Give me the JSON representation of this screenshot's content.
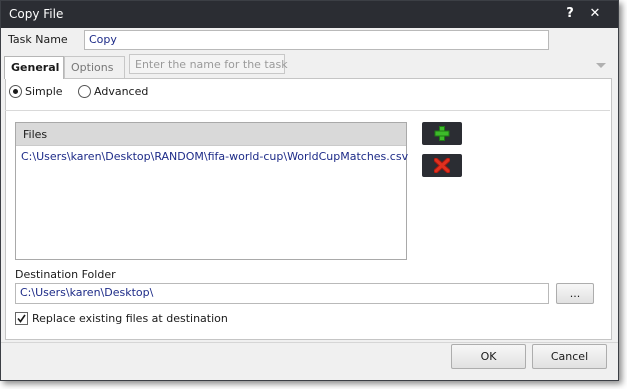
{
  "window": {
    "title": "Copy File",
    "help_label": "?",
    "close_label": "✕"
  },
  "task": {
    "label": "Task Name",
    "value": "Copy"
  },
  "tabs": [
    {
      "label": "General",
      "active": true
    },
    {
      "label": "Options",
      "active": false
    }
  ],
  "tooltip": "Enter the name for the task",
  "mode": {
    "options": [
      {
        "label": "Simple",
        "selected": true
      },
      {
        "label": "Advanced",
        "selected": false
      }
    ]
  },
  "files": {
    "header": "Files",
    "items": [
      "C:\\Users\\karen\\Desktop\\RANDOM\\fifa-world-cup\\WorldCupMatches.csv"
    ]
  },
  "destination": {
    "label": "Destination Folder",
    "value": "C:\\Users\\karen\\Desktop\\",
    "browse_label": "..."
  },
  "replace": {
    "label": "Replace existing files at destination",
    "checked": true
  },
  "buttons": {
    "ok": "OK",
    "cancel": "Cancel"
  },
  "icons": {
    "add": "plus-icon",
    "remove": "delete-icon"
  },
  "colors": {
    "titlebar": "#2b2d33",
    "value_text": "#1d2b88",
    "add_green": "#3dbb2a",
    "remove_red": "#e0301e"
  }
}
